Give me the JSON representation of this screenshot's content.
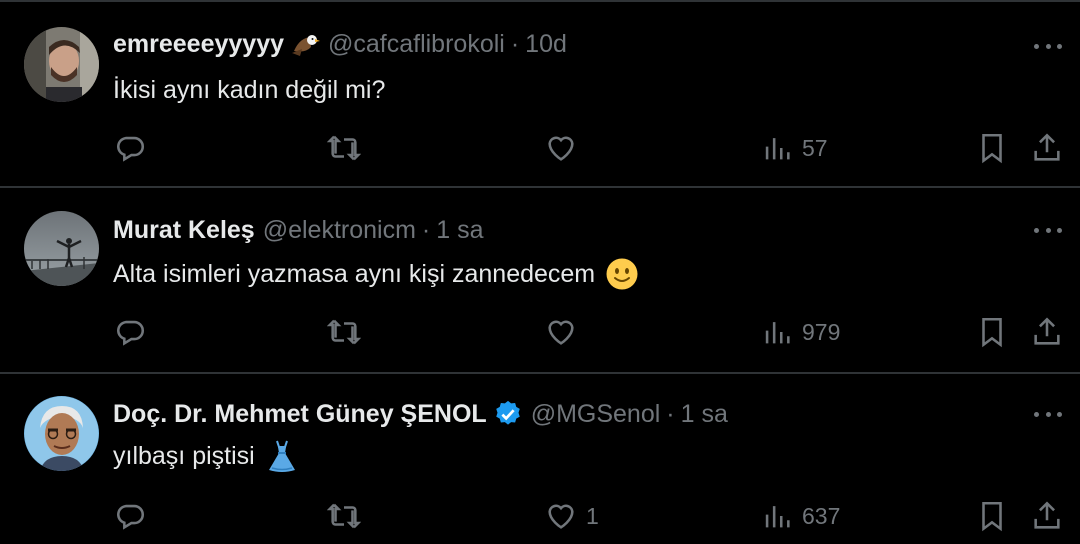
{
  "tweets": [
    {
      "name": "emreeeeyyyyy",
      "name_emoji": "eagle-icon",
      "handle": "@cafcaflibrokoli",
      "dot": "·",
      "time": "10d",
      "text": "İkisi aynı kadın değil mi?",
      "likes": "",
      "views": "57"
    },
    {
      "name": "Murat Keleş",
      "handle": "@elektronicm",
      "dot": "·",
      "time": "1 sa",
      "text": "Alta isimleri yazmasa aynı kişi zannedecem",
      "text_emoji": "slightly-smiling-face-icon",
      "likes": "",
      "views": "979"
    },
    {
      "name": "Doç. Dr. Mehmet Güney ŞENOL",
      "verified": true,
      "handle": "@MGSenol",
      "dot": "·",
      "time": "1 sa",
      "text": "yılbaşı piştisi",
      "text_emoji": "dress-icon",
      "likes": "1",
      "views": "637"
    }
  ],
  "colors": {
    "background": "#000000",
    "text": "#e7e9ea",
    "muted": "#71767b",
    "divider": "#2f3336",
    "verified": "#1d9bf0"
  }
}
